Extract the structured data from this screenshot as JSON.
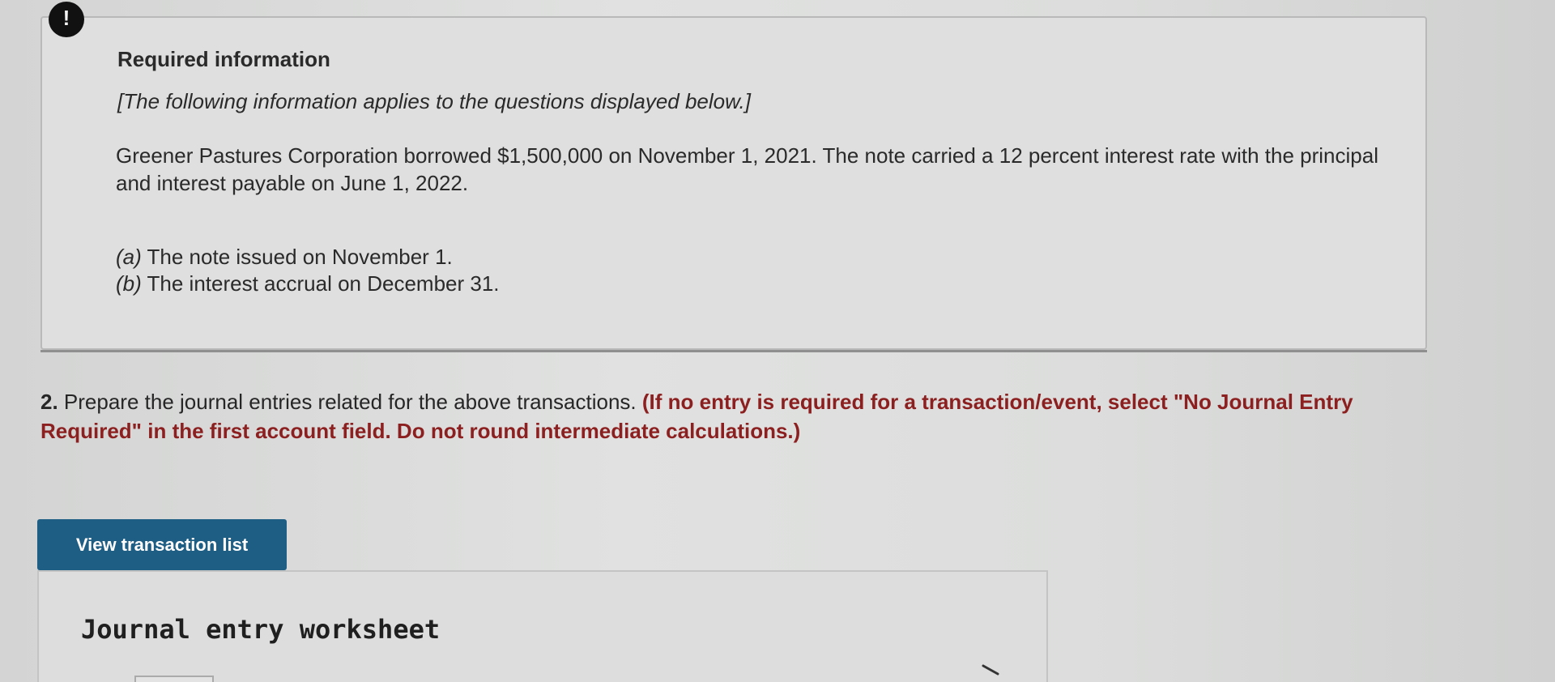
{
  "alert": {
    "symbol": "!",
    "icon": "exclamation-icon"
  },
  "info": {
    "title": "Required information",
    "note": "[The following information applies to the questions displayed below.]",
    "body": "Greener Pastures Corporation borrowed $1,500,000 on November 1, 2021. The note carried a 12 percent interest rate with the principal and interest payable on June 1, 2022.",
    "items": [
      {
        "letter": "(a)",
        "text": " The note issued on November 1."
      },
      {
        "letter": "(b)",
        "text": " The interest accrual on December 31."
      }
    ]
  },
  "question": {
    "number": "2.",
    "text": " Prepare the journal entries related for the above transactions. ",
    "instruction": "(If no entry is required for a transaction/event, select \"No Journal Entry Required\" in the first account field. Do not round intermediate calculations.)"
  },
  "buttons": {
    "view_transaction_list": "View transaction list"
  },
  "worksheet": {
    "title": "Journal entry worksheet",
    "next_icon": "chevron-right-icon"
  },
  "colors": {
    "button_bg": "#1f5e84",
    "instruction_red": "#8c1f1f"
  }
}
